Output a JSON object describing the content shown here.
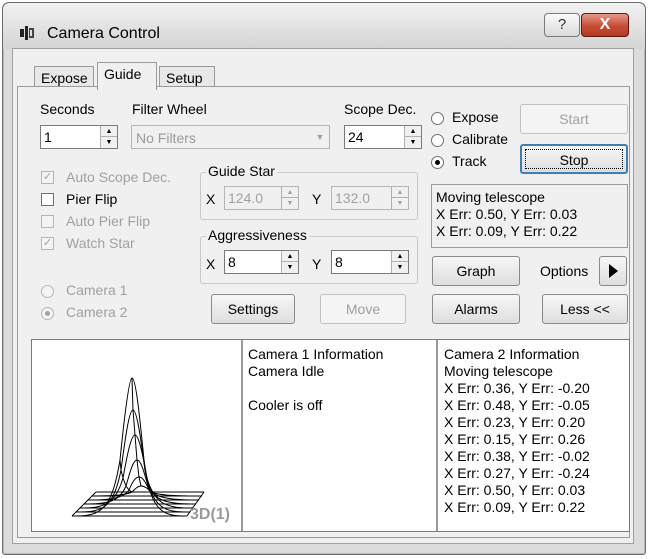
{
  "window": {
    "title": "Camera Control",
    "help_label": "?",
    "close_label": "X"
  },
  "tabs": [
    {
      "label": "Expose",
      "active": false
    },
    {
      "label": "Guide",
      "active": true
    },
    {
      "label": "Setup",
      "active": false
    }
  ],
  "guide": {
    "seconds_label": "Seconds",
    "seconds_value": "1",
    "filter_wheel_label": "Filter Wheel",
    "filter_wheel_value": "No Filters",
    "scope_dec_label": "Scope Dec.",
    "scope_dec_value": "24",
    "mode_options": [
      {
        "label": "Expose",
        "selected": false
      },
      {
        "label": "Calibrate",
        "selected": false
      },
      {
        "label": "Track",
        "selected": true
      }
    ],
    "start_label": "Start",
    "stop_label": "Stop",
    "checkboxes": [
      {
        "label": "Auto Scope Dec.",
        "checked": true,
        "enabled": false
      },
      {
        "label": "Pier Flip",
        "checked": false,
        "enabled": true
      },
      {
        "label": "Auto Pier Flip",
        "checked": false,
        "enabled": false
      },
      {
        "label": "Watch Star",
        "checked": true,
        "enabled": false
      }
    ],
    "guide_star": {
      "title": "Guide Star",
      "x_label": "X",
      "x_value": "124.0",
      "y_label": "Y",
      "y_value": "132.0"
    },
    "aggressiveness": {
      "title": "Aggressiveness",
      "x_label": "X",
      "x_value": "8",
      "y_label": "Y",
      "y_value": "8"
    },
    "status_lines": [
      "Moving telescope",
      "X Err: 0.50, Y Err: 0.03",
      "X Err: 0.09, Y Err: 0.22"
    ],
    "graph_label": "Graph",
    "options_label": "Options",
    "camera_options": [
      {
        "label": "Camera 1",
        "selected": false
      },
      {
        "label": "Camera 2",
        "selected": true
      }
    ],
    "settings_label": "Settings",
    "move_label": "Move",
    "alarms_label": "Alarms",
    "less_label": "Less <<"
  },
  "plot": {
    "label": "3D(1)"
  },
  "camera1_info": {
    "lines": [
      "Camera 1 Information",
      "Camera Idle",
      "",
      "Cooler is off"
    ]
  },
  "camera2_info": {
    "lines": [
      "Camera 2 Information",
      "Moving telescope",
      "X Err: 0.36, Y Err: -0.20",
      "X Err: 0.48, Y Err: -0.05",
      "X Err: 0.23, Y Err: 0.20",
      "X Err: 0.15, Y Err: 0.26",
      "X Err: 0.38, Y Err: -0.02",
      "X Err: 0.27, Y Err: -0.24",
      "X Err: 0.50, Y Err: 0.03",
      "X Err: 0.09, Y Err: 0.22"
    ]
  }
}
